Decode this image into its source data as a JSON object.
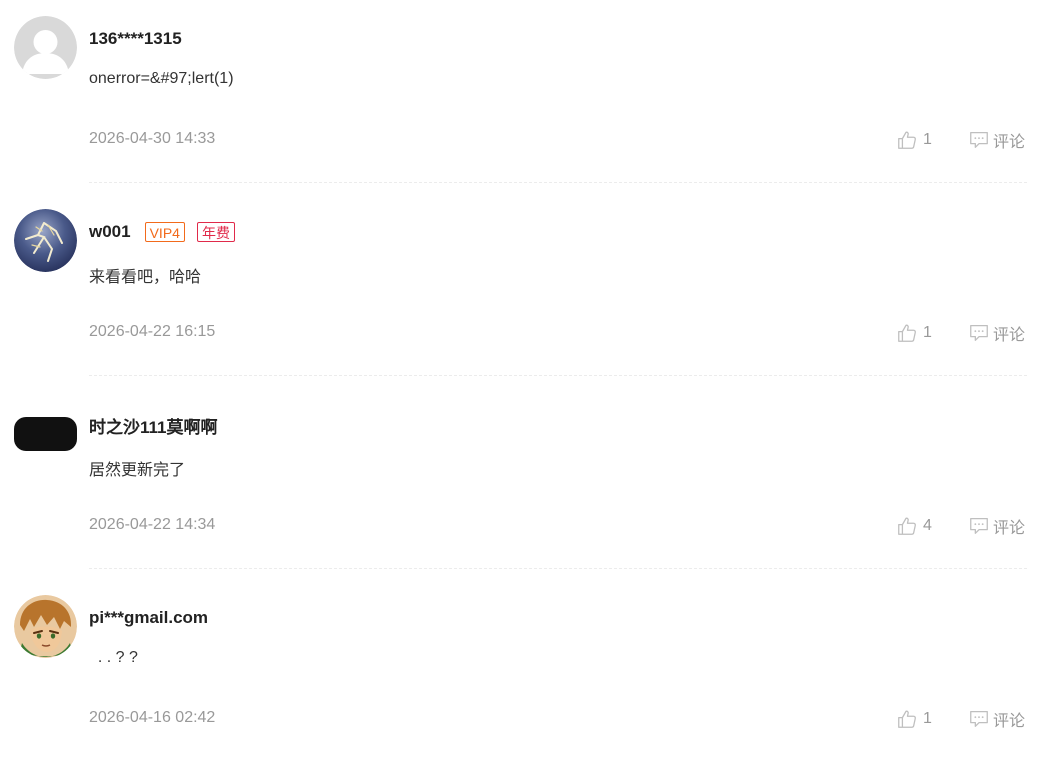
{
  "comments": [
    {
      "username": "136****1315",
      "avatar": "default-avatar-icon",
      "badges": [],
      "content": "onerror=&#97;lert(1)",
      "date": "2026-04-30 14:33",
      "likes": "1",
      "comment_label": "评论"
    },
    {
      "username": "w001",
      "avatar": "lightning-avatar",
      "badges": [
        "VIP4",
        "年费"
      ],
      "content": "来看看吧，哈哈",
      "date": "2026-04-22 16:15",
      "likes": "1",
      "comment_label": "评论"
    },
    {
      "username": "时之沙111莫啊啊",
      "avatar": "black-avatar",
      "badges": [],
      "content": "居然更新完了",
      "date": "2026-04-22 14:34",
      "likes": "4",
      "comment_label": "评论"
    },
    {
      "username": "pi***gmail.com",
      "avatar": "anime-character-avatar",
      "badges": [],
      "content": "  . . ? ?",
      "date": "2026-04-16 02:42",
      "likes": "1",
      "comment_label": "评论"
    }
  ],
  "colors": {
    "vip_badge": "#f26a1b",
    "year_badge": "#e02a4a",
    "meta_text": "#999999",
    "username": "#222222"
  }
}
